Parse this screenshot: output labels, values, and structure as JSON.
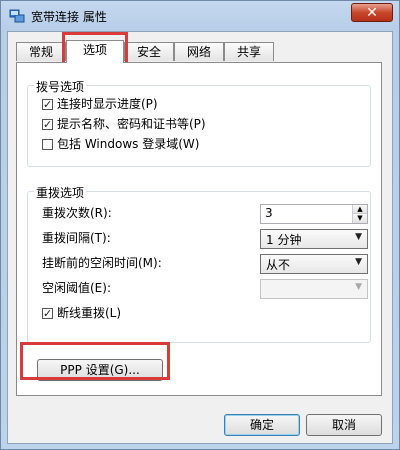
{
  "window": {
    "title": "宽带连接 属性",
    "close_symbol": "✕"
  },
  "tabs": [
    {
      "label": "常规",
      "active": false
    },
    {
      "label": "选项",
      "active": true
    },
    {
      "label": "安全",
      "active": false
    },
    {
      "label": "网络",
      "active": false
    },
    {
      "label": "共享",
      "active": false
    }
  ],
  "dial_options": {
    "title": "拨号选项",
    "items": [
      {
        "label": "连接时显示进度(P)",
        "checked": true
      },
      {
        "label": "提示名称、密码和证书等(P)",
        "checked": true
      },
      {
        "label": "包括 Windows 登录域(W)",
        "checked": false
      }
    ]
  },
  "redial_options": {
    "title": "重拨选项",
    "redial_count_label": "重拨次数(R):",
    "redial_count_value": "3",
    "redial_interval_label": "重拨间隔(T):",
    "redial_interval_value": "1 分钟",
    "idle_hangup_label": "挂断前的空闲时间(M):",
    "idle_hangup_value": "从不",
    "idle_threshold_label": "空闲阈值(E):",
    "idle_threshold_value": "",
    "redial_on_disconnect_label": "断线重拨(L)",
    "redial_on_disconnect_checked": true
  },
  "ppp_button_label": "PPP 设置(G)...",
  "footer": {
    "ok_label": "确定",
    "cancel_label": "取消"
  },
  "colors": {
    "highlight": "#d93a3a"
  }
}
